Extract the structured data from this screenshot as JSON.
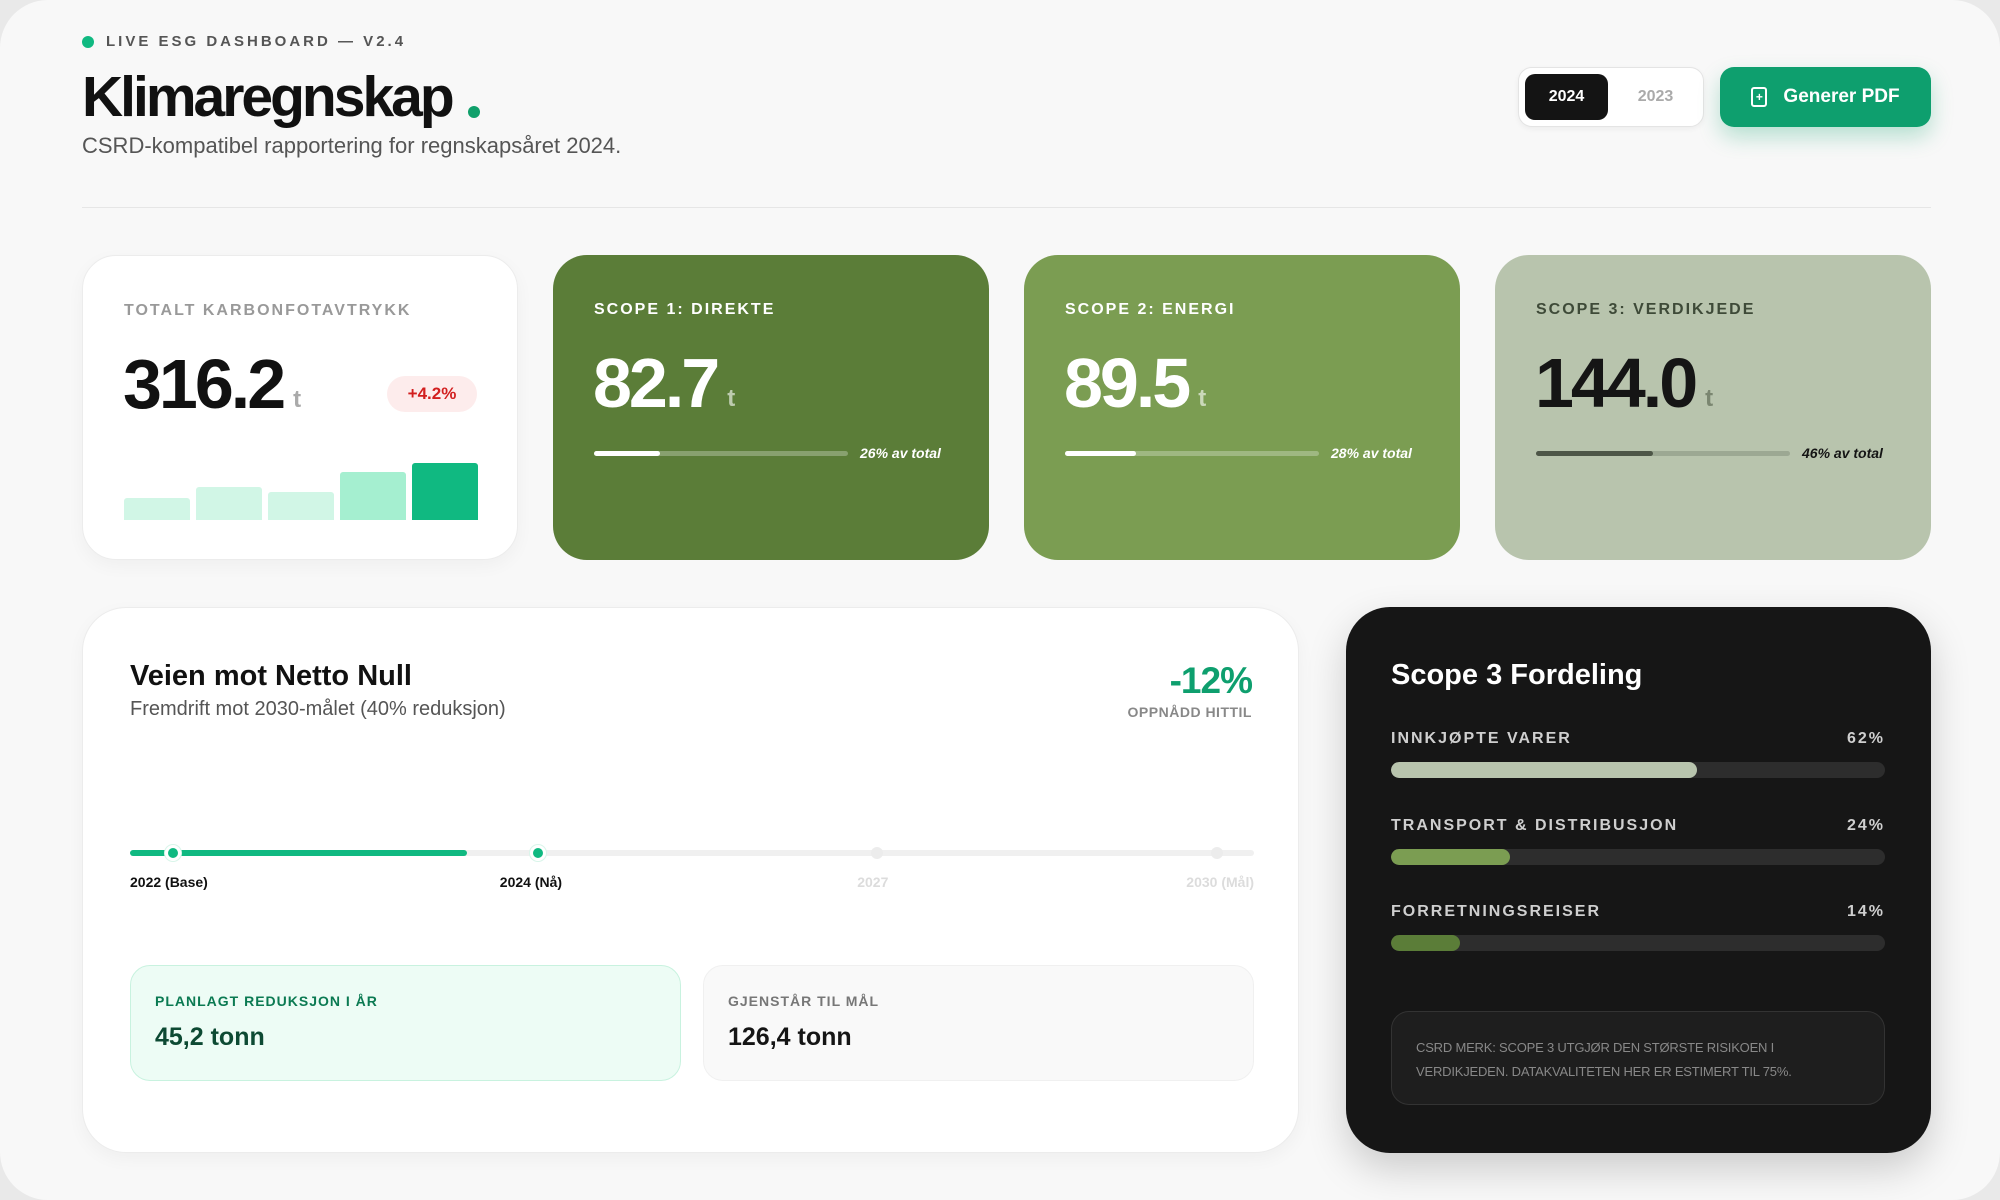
{
  "header": {
    "eyebrow": "LIVE ESG DASHBOARD — V2.4",
    "title": "Klimaregnskap",
    "subtitle": "CSRD-kompatibel rapportering for regnskapsåret 2024.",
    "years": [
      {
        "label": "2024",
        "active": true
      },
      {
        "label": "2023",
        "active": false
      }
    ],
    "pdf_button": "Generer PDF",
    "icons": {
      "pdf": "file-plus-icon",
      "live": "live-dot"
    }
  },
  "cards": {
    "total": {
      "label": "TOTALT KARBONFOTAVTRYKK",
      "value": "316.2",
      "unit": "t",
      "change": "+4.2%",
      "trend": [
        0.34,
        0.5,
        0.43,
        0.72,
        0.86
      ]
    },
    "scope1": {
      "label": "SCOPE 1: DIREKTE",
      "value": "82.7",
      "unit": "t",
      "share": 0.26,
      "share_label": "26% av total"
    },
    "scope2": {
      "label": "SCOPE 2: ENERGI",
      "value": "89.5",
      "unit": "t",
      "share": 0.28,
      "share_label": "28% av total"
    },
    "scope3": {
      "label": "SCOPE 3: VERDIKJEDE",
      "value": "144.0",
      "unit": "t",
      "share": 0.46,
      "share_label": "46% av total"
    }
  },
  "netzero": {
    "title": "Veien mot Netto Null",
    "subtitle": "Fremdrift mot 2030-målet (40% reduksjon)",
    "kpi_value": "-12%",
    "kpi_label": "OPPNÅDD HITTIL",
    "progress": 0.3,
    "milestones": [
      {
        "label": "2022 (Base)",
        "done": true
      },
      {
        "label": "2024 (Nå)",
        "done": true
      },
      {
        "label": "2027",
        "done": false
      },
      {
        "label": "2030 (Mål)",
        "done": false
      }
    ],
    "planned_label": "PLANLAGT REDUKSJON I ÅR",
    "planned_value": "45,2 tonn",
    "remaining_label": "GJENSTÅR TIL MÅL",
    "remaining_value": "126,4 tonn"
  },
  "breakdown": {
    "title": "Scope 3 Fordeling",
    "items": [
      {
        "label": "INNKJØPTE VARER",
        "pct_label": "62%",
        "pct": 0.62,
        "color": "#b8c4ad"
      },
      {
        "label": "TRANSPORT & DISTRIBUSJON",
        "pct_label": "24%",
        "pct": 0.24,
        "color": "#7b9d52"
      },
      {
        "label": "FORRETNINGSREISER",
        "pct_label": "14%",
        "pct": 0.14,
        "color": "#5b7d38"
      }
    ],
    "note": "CSRD MERK: SCOPE 3 UTGJØR DEN STØRSTE RISIKOEN I VERDIKJEDEN. DATAKVALITETEN HER ER ESTIMERT TIL 75%."
  },
  "colors": {
    "accent": "#10b981",
    "accent_dark": "#0e9f6e",
    "scope1": "#5b7d38",
    "scope2": "#7b9d52",
    "scope3": "#b8c4ad",
    "negative": "#d21f1f"
  }
}
